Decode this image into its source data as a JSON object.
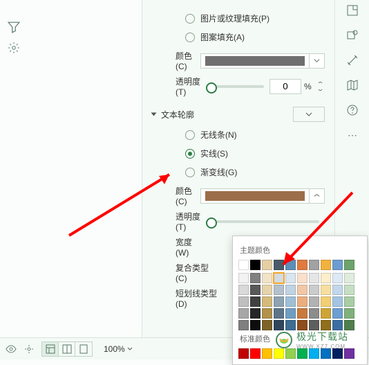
{
  "fill": {
    "radios": {
      "pattern_texture": "图片或纹理填充(P)",
      "pattern": "图案填充(A)"
    },
    "color_label": "颜色(C)",
    "color_value": "#6f6f6f",
    "opacity_label": "透明度(T)",
    "opacity_value": "0",
    "opacity_unit": "%"
  },
  "outline": {
    "section_title": "文本轮廓",
    "radios": {
      "none": "无线条(N)",
      "solid": "实线(S)",
      "gradient": "渐变线(G)"
    },
    "selected": "solid",
    "color_label": "颜色(C)",
    "color_value": "#9c6e49",
    "opacity_label": "透明度(T)",
    "width_label": "宽度(W)",
    "compound_label": "复合类型(C)",
    "dash_label": "短划线类型(D)"
  },
  "color_popup": {
    "theme_title": "主题颜色",
    "standard_title": "标准颜色",
    "theme_row1": [
      "#ffffff",
      "#000000",
      "#e7cfa5",
      "#4a5c6a",
      "#5c8eb8",
      "#e07a3f",
      "#a2a2a2",
      "#f1b23e",
      "#6d9cd0",
      "#6ca36c"
    ],
    "theme_shades": [
      [
        "#f2f2f2",
        "#808080",
        "#f2e4c9",
        "#d3dbe3",
        "#d9e5ef",
        "#f8e0cd",
        "#e6e6e6",
        "#fbeecd",
        "#dde9f4",
        "#e0edde"
      ],
      [
        "#d9d9d9",
        "#595959",
        "#e6d3aa",
        "#b4c1cc",
        "#bfd3e2",
        "#f2c7a6",
        "#cccccc",
        "#f7dfa0",
        "#c2d7eb",
        "#c6dec3"
      ],
      [
        "#bfbfbf",
        "#404040",
        "#d5ba7b",
        "#8ea2b2",
        "#9fbfd6",
        "#ebad7d",
        "#b2b2b2",
        "#f2cf73",
        "#a3c4e2",
        "#a9cda5"
      ],
      [
        "#a6a6a6",
        "#262626",
        "#b3914a",
        "#5d7489",
        "#6f9dc1",
        "#c9793c",
        "#8c8c8c",
        "#cea436",
        "#6c9ed0",
        "#7fb17a"
      ],
      [
        "#7f7f7f",
        "#0d0d0d",
        "#7e6328",
        "#31465c",
        "#3e6d94",
        "#8e4d1d",
        "#5e5e5e",
        "#8e6f1d",
        "#3d6fa3",
        "#4f7f4b"
      ]
    ],
    "standard": [
      "#c00000",
      "#ff0000",
      "#ffc000",
      "#ffff00",
      "#92d050",
      "#00b050",
      "#00b0f0",
      "#0070c0",
      "#002060",
      "#7030a0"
    ],
    "selected_index": [
      0,
      3
    ]
  },
  "bottom": {
    "zoom": "100%"
  },
  "watermark": {
    "text": "极光下载站",
    "sub": "WWW.XZ7.COM"
  }
}
